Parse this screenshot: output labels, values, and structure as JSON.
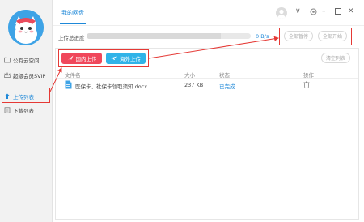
{
  "sidebar": {
    "items": [
      {
        "label": "公有云空间",
        "icon": "folder-icon"
      },
      {
        "label": "超级会员SVIP",
        "icon": "crown-icon"
      },
      {
        "label": "上传列表",
        "icon": "upload-list-icon",
        "active": true
      },
      {
        "label": "下载列表",
        "icon": "download-list-icon"
      }
    ]
  },
  "header": {
    "tab_title": "我的网盘"
  },
  "progress": {
    "label": "上传总进度",
    "speed": "0 B/s",
    "fill_percent": 82
  },
  "actions": {
    "pause_all": "全部暂停",
    "start_all": "全部开始",
    "clear_list": "清空列表"
  },
  "upload_modes": {
    "domestic": "国内上传",
    "overseas": "海外上传"
  },
  "table": {
    "columns": [
      "文件名",
      "大小",
      "状态",
      "操作"
    ],
    "rows": [
      {
        "filename": "医保卡、社保卡领取须知.docx",
        "size": "237 KB",
        "status": "已完成"
      }
    ]
  },
  "colors": {
    "accent": "#1e88d8",
    "annotation": "#e53935",
    "domestic_button": "#f0475b",
    "overseas_button": "#30b3e8"
  }
}
